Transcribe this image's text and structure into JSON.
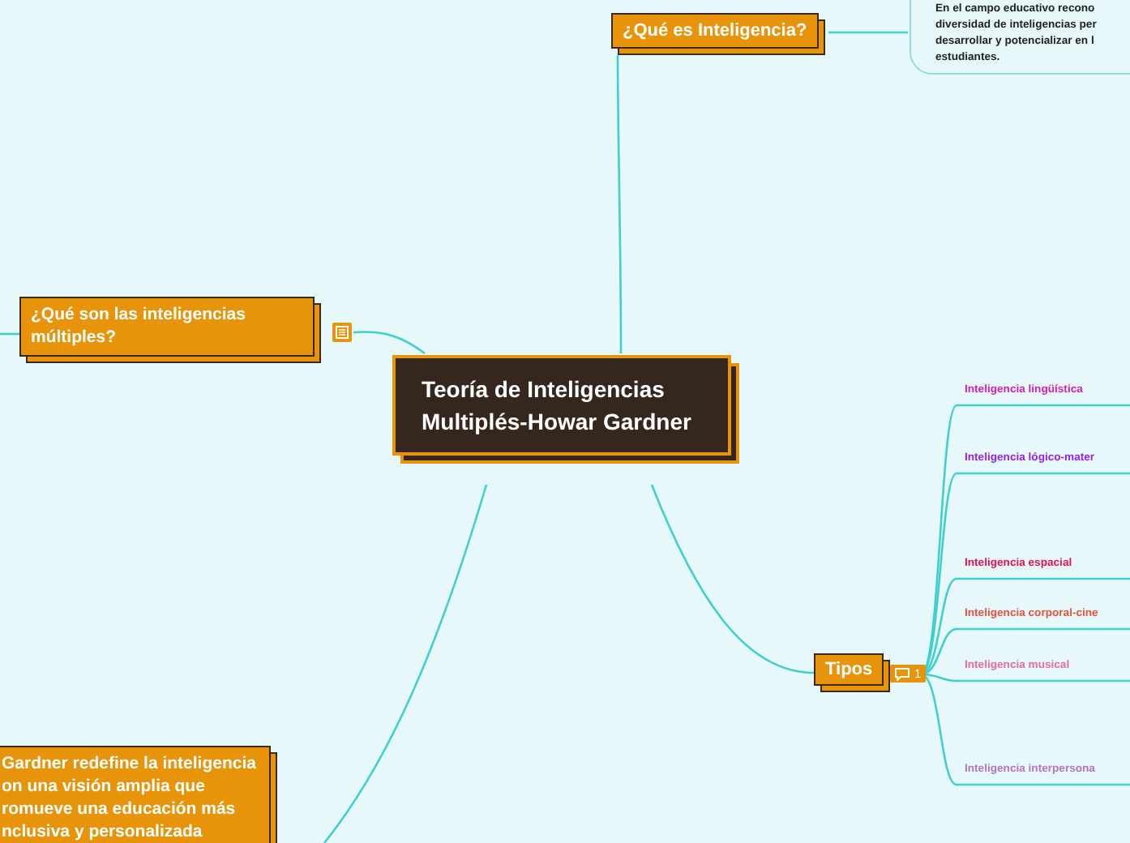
{
  "central": {
    "title": "Teoría de Inteligencias Multiplés-Howar Gardner"
  },
  "topics": [
    {
      "kind": "top",
      "label": "¿Qué es Inteligencia?",
      "note_lines": [
        "En el campo educativo recono",
        "diversidad de inteligencias per",
        "desarrollar y potencializar en l",
        "estudiantes."
      ]
    },
    {
      "kind": "left",
      "label": "¿Qué son las inteligencias múltiples?",
      "has_note": true
    },
    {
      "kind": "tipos",
      "label": "Tipos",
      "comment_count": "1",
      "children": [
        {
          "label": "Inteligencia lingüística",
          "color": "#d81fb4"
        },
        {
          "label": "Inteligencia lógico-mater",
          "color": "#9a22e6"
        },
        {
          "label": "Inteligencia espacial",
          "color": "#e3124e"
        },
        {
          "label": "Inteligencia corporal-cine",
          "color": "#e4553e"
        },
        {
          "label": "Inteligencia musical",
          "color": "#ea6aa0"
        },
        {
          "label": "Inteligencia interpersona",
          "color": "#b574c6"
        }
      ]
    },
    {
      "kind": "bottom",
      "lines": [
        "Gardner redefine la inteligencia",
        "on una visión amplia que",
        "romueve una educación más",
        "nclusiva y personalizada"
      ]
    }
  ]
}
